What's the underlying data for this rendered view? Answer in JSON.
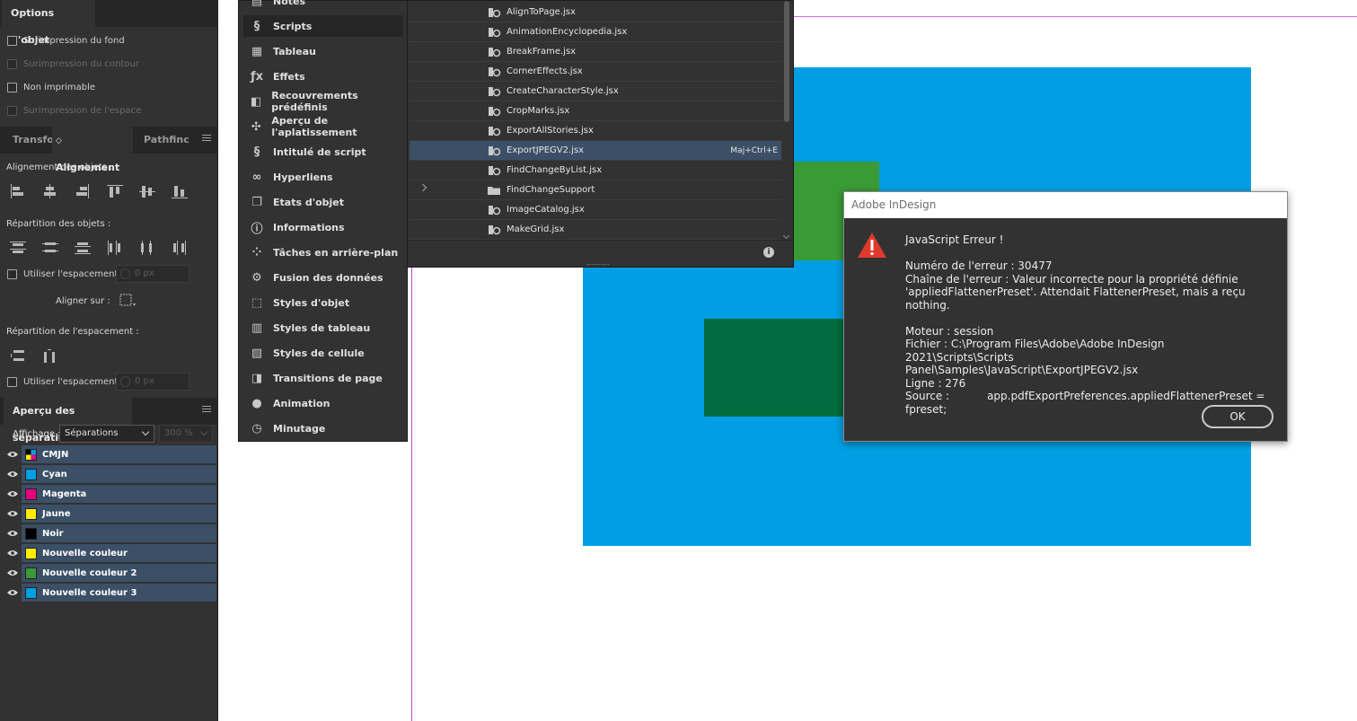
{
  "object_options": {
    "tab": "Options d'objet",
    "checkboxes": [
      {
        "label": "Surimpression du fond",
        "enabled": true
      },
      {
        "label": "Surimpression du contour",
        "enabled": false
      },
      {
        "label": "Non imprimable",
        "enabled": true
      },
      {
        "label": "Surimpression de l'espace",
        "enabled": false
      }
    ]
  },
  "align_panel": {
    "tabs": [
      "Transfor",
      "Alignement",
      "Pathfinc"
    ],
    "align_objects_label": "Alignement des objets :",
    "distribute_objects_label": "Répartition des objets :",
    "use_spacing_label": "Utiliser l'espacement",
    "spacing_value": "0 px",
    "align_to_label": "Aligner sur :",
    "distribute_spacing_label": "Répartition de l'espacement :",
    "use_spacing_label_2": "Utiliser l'espacement",
    "spacing_value_2": "0 px"
  },
  "separations": {
    "tab": "Aperçu des séparations",
    "view_label": "Affichage :",
    "view_value": "Séparations",
    "zoom_value": "300 %",
    "rows": [
      {
        "name": "CMJN",
        "color": "cmyk"
      },
      {
        "name": "Cyan",
        "color": "#009fe3"
      },
      {
        "name": "Magenta",
        "color": "#e5007d"
      },
      {
        "name": "Jaune",
        "color": "#ffed00"
      },
      {
        "name": "Noir",
        "color": "#000000"
      },
      {
        "name": "Nouvelle couleur",
        "color": "#ffed00"
      },
      {
        "name": "Nouvelle couleur 2",
        "color": "#3a9a35"
      },
      {
        "name": "Nouvelle couleur 3",
        "color": "#009fe3"
      }
    ]
  },
  "dock": {
    "items": [
      {
        "label": "Notes",
        "icon": "notes-icon"
      },
      {
        "label": "Scripts",
        "icon": "scripts-icon"
      },
      {
        "label": "Tableau",
        "icon": "table-icon"
      },
      {
        "label": "Effets",
        "icon": "fx-icon"
      },
      {
        "label": "Recouvrements prédéfinis",
        "icon": "trap-presets-icon"
      },
      {
        "label": "Aperçu de l'aplatissement",
        "icon": "flattener-preview-icon"
      },
      {
        "label": "Intitulé de script",
        "icon": "script-label-icon"
      },
      {
        "label": "Hyperliens",
        "icon": "hyperlinks-icon"
      },
      {
        "label": "Etats d'objet",
        "icon": "object-states-icon"
      },
      {
        "label": "Informations",
        "icon": "info-icon"
      },
      {
        "label": "Tâches en arrière-plan",
        "icon": "background-tasks-icon"
      },
      {
        "label": "Fusion des données",
        "icon": "data-merge-icon"
      },
      {
        "label": "Styles d'objet",
        "icon": "object-styles-icon"
      },
      {
        "label": "Styles de tableau",
        "icon": "table-styles-icon"
      },
      {
        "label": "Styles de cellule",
        "icon": "cell-styles-icon"
      },
      {
        "label": "Transitions de page",
        "icon": "page-transitions-icon"
      },
      {
        "label": "Animation",
        "icon": "animation-icon"
      },
      {
        "label": "Minutage",
        "icon": "timing-icon"
      }
    ]
  },
  "scripts_panel": {
    "rows": [
      {
        "name": "AlignToPage.jsx"
      },
      {
        "name": "AnimationEncyclopedia.jsx"
      },
      {
        "name": "BreakFrame.jsx"
      },
      {
        "name": "CornerEffects.jsx"
      },
      {
        "name": "CreateCharacterStyle.jsx"
      },
      {
        "name": "CropMarks.jsx"
      },
      {
        "name": "ExportAllStories.jsx"
      },
      {
        "name": "ExportJPEGV2.jsx",
        "shortcut": "Maj+Ctrl+E"
      },
      {
        "name": "FindChangeByList.jsx"
      },
      {
        "name": "FindChangeSupport",
        "folder": true
      },
      {
        "name": "ImageCatalog.jsx"
      },
      {
        "name": "MakeGrid.jsx"
      }
    ],
    "info_glyph": "i"
  },
  "dialog": {
    "title": "Adobe InDesign",
    "heading": "JavaScript Erreur !",
    "error_number": "Numéro de l'erreur : 30477",
    "error_string_1": "Chaîne de l'erreur : Valeur incorrecte pour la propriété définie",
    "error_string_2": "'appliedFlattenerPreset'. Attendait FlattenerPreset, mais a reçu nothing.",
    "engine": "Moteur : session",
    "file_1": "Fichier : C:\\Program Files\\Adobe\\Adobe InDesign 2021\\Scripts\\Scripts",
    "file_2": "Panel\\Samples\\JavaScript\\ExportJPEGV2.jsx",
    "line": "Ligne : 276",
    "source_label": "Source :",
    "source_code_1": "app.pdfExportPreferences.appliedFlattenerPreset =",
    "source_code_2": "fpreset;",
    "ok_label": "OK"
  }
}
